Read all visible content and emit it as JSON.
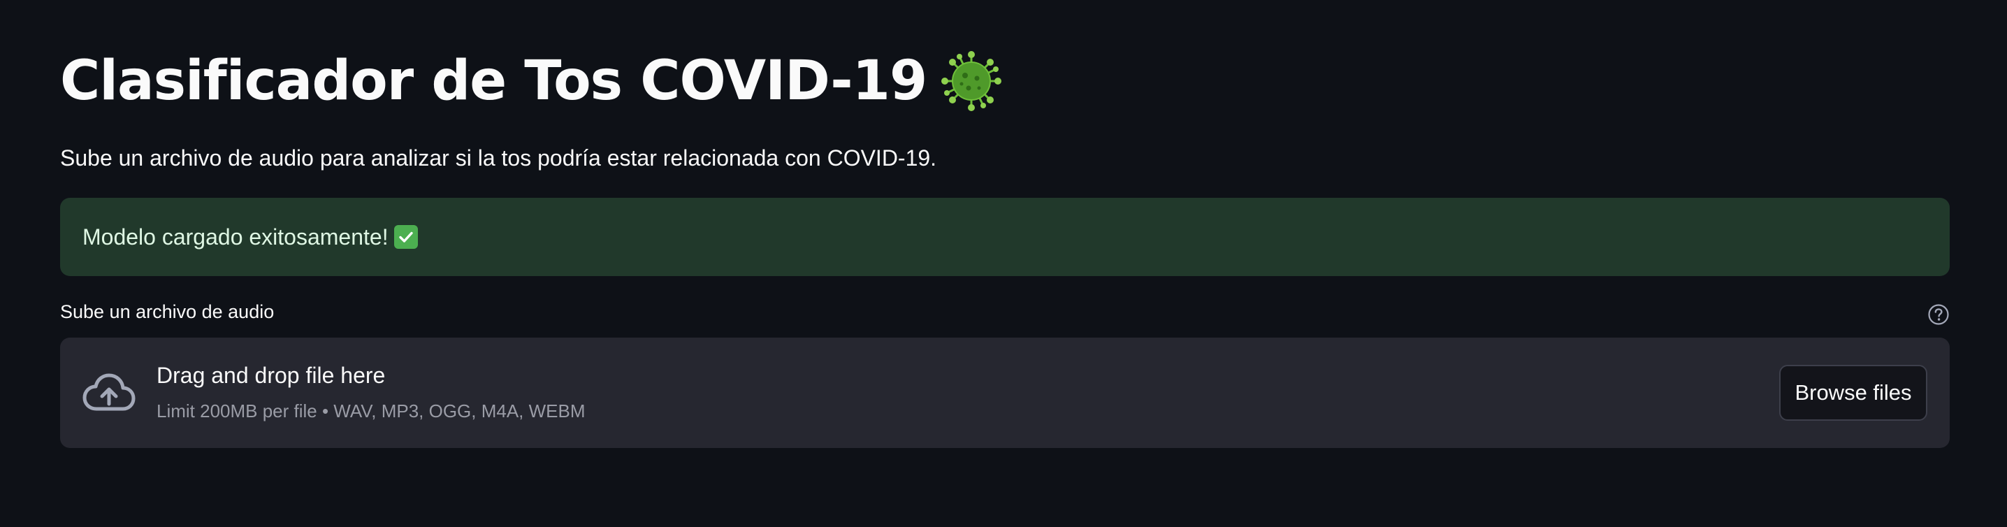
{
  "header": {
    "title": "Clasificador de Tos COVID-19",
    "title_icon": "virus-icon",
    "subtitle": "Sube un archivo de audio para analizar si la tos podría estar relacionada con COVID-19."
  },
  "alert": {
    "message": "Modelo cargado exitosamente!",
    "icon": "check-mark-icon",
    "background_color": "#21392b"
  },
  "uploader": {
    "label": "Sube un archivo de audio",
    "help_icon": "help-circle-icon",
    "drop_title": "Drag and drop file here",
    "drop_limits": "Limit 200MB per file • WAV, MP3, OGG, M4A, WEBM",
    "upload_icon": "cloud-upload-icon",
    "browse_label": "Browse files"
  },
  "theme": {
    "background": "#0e1117",
    "surface": "#262730",
    "text": "#fafafa",
    "muted_text": "#9a9ca6"
  }
}
